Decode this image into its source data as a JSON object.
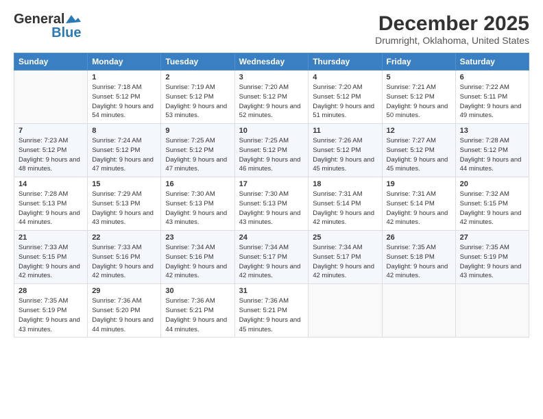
{
  "header": {
    "logo_general": "General",
    "logo_blue": "Blue",
    "title": "December 2025",
    "subtitle": "Drumright, Oklahoma, United States"
  },
  "weekdays": [
    "Sunday",
    "Monday",
    "Tuesday",
    "Wednesday",
    "Thursday",
    "Friday",
    "Saturday"
  ],
  "weeks": [
    [
      {
        "day": "",
        "sunrise": "",
        "sunset": "",
        "daylight": ""
      },
      {
        "day": "1",
        "sunrise": "Sunrise: 7:18 AM",
        "sunset": "Sunset: 5:12 PM",
        "daylight": "Daylight: 9 hours and 54 minutes."
      },
      {
        "day": "2",
        "sunrise": "Sunrise: 7:19 AM",
        "sunset": "Sunset: 5:12 PM",
        "daylight": "Daylight: 9 hours and 53 minutes."
      },
      {
        "day": "3",
        "sunrise": "Sunrise: 7:20 AM",
        "sunset": "Sunset: 5:12 PM",
        "daylight": "Daylight: 9 hours and 52 minutes."
      },
      {
        "day": "4",
        "sunrise": "Sunrise: 7:20 AM",
        "sunset": "Sunset: 5:12 PM",
        "daylight": "Daylight: 9 hours and 51 minutes."
      },
      {
        "day": "5",
        "sunrise": "Sunrise: 7:21 AM",
        "sunset": "Sunset: 5:12 PM",
        "daylight": "Daylight: 9 hours and 50 minutes."
      },
      {
        "day": "6",
        "sunrise": "Sunrise: 7:22 AM",
        "sunset": "Sunset: 5:11 PM",
        "daylight": "Daylight: 9 hours and 49 minutes."
      }
    ],
    [
      {
        "day": "7",
        "sunrise": "Sunrise: 7:23 AM",
        "sunset": "Sunset: 5:12 PM",
        "daylight": "Daylight: 9 hours and 48 minutes."
      },
      {
        "day": "8",
        "sunrise": "Sunrise: 7:24 AM",
        "sunset": "Sunset: 5:12 PM",
        "daylight": "Daylight: 9 hours and 47 minutes."
      },
      {
        "day": "9",
        "sunrise": "Sunrise: 7:25 AM",
        "sunset": "Sunset: 5:12 PM",
        "daylight": "Daylight: 9 hours and 47 minutes."
      },
      {
        "day": "10",
        "sunrise": "Sunrise: 7:25 AM",
        "sunset": "Sunset: 5:12 PM",
        "daylight": "Daylight: 9 hours and 46 minutes."
      },
      {
        "day": "11",
        "sunrise": "Sunrise: 7:26 AM",
        "sunset": "Sunset: 5:12 PM",
        "daylight": "Daylight: 9 hours and 45 minutes."
      },
      {
        "day": "12",
        "sunrise": "Sunrise: 7:27 AM",
        "sunset": "Sunset: 5:12 PM",
        "daylight": "Daylight: 9 hours and 45 minutes."
      },
      {
        "day": "13",
        "sunrise": "Sunrise: 7:28 AM",
        "sunset": "Sunset: 5:12 PM",
        "daylight": "Daylight: 9 hours and 44 minutes."
      }
    ],
    [
      {
        "day": "14",
        "sunrise": "Sunrise: 7:28 AM",
        "sunset": "Sunset: 5:13 PM",
        "daylight": "Daylight: 9 hours and 44 minutes."
      },
      {
        "day": "15",
        "sunrise": "Sunrise: 7:29 AM",
        "sunset": "Sunset: 5:13 PM",
        "daylight": "Daylight: 9 hours and 43 minutes."
      },
      {
        "day": "16",
        "sunrise": "Sunrise: 7:30 AM",
        "sunset": "Sunset: 5:13 PM",
        "daylight": "Daylight: 9 hours and 43 minutes."
      },
      {
        "day": "17",
        "sunrise": "Sunrise: 7:30 AM",
        "sunset": "Sunset: 5:13 PM",
        "daylight": "Daylight: 9 hours and 43 minutes."
      },
      {
        "day": "18",
        "sunrise": "Sunrise: 7:31 AM",
        "sunset": "Sunset: 5:14 PM",
        "daylight": "Daylight: 9 hours and 42 minutes."
      },
      {
        "day": "19",
        "sunrise": "Sunrise: 7:31 AM",
        "sunset": "Sunset: 5:14 PM",
        "daylight": "Daylight: 9 hours and 42 minutes."
      },
      {
        "day": "20",
        "sunrise": "Sunrise: 7:32 AM",
        "sunset": "Sunset: 5:15 PM",
        "daylight": "Daylight: 9 hours and 42 minutes."
      }
    ],
    [
      {
        "day": "21",
        "sunrise": "Sunrise: 7:33 AM",
        "sunset": "Sunset: 5:15 PM",
        "daylight": "Daylight: 9 hours and 42 minutes."
      },
      {
        "day": "22",
        "sunrise": "Sunrise: 7:33 AM",
        "sunset": "Sunset: 5:16 PM",
        "daylight": "Daylight: 9 hours and 42 minutes."
      },
      {
        "day": "23",
        "sunrise": "Sunrise: 7:34 AM",
        "sunset": "Sunset: 5:16 PM",
        "daylight": "Daylight: 9 hours and 42 minutes."
      },
      {
        "day": "24",
        "sunrise": "Sunrise: 7:34 AM",
        "sunset": "Sunset: 5:17 PM",
        "daylight": "Daylight: 9 hours and 42 minutes."
      },
      {
        "day": "25",
        "sunrise": "Sunrise: 7:34 AM",
        "sunset": "Sunset: 5:17 PM",
        "daylight": "Daylight: 9 hours and 42 minutes."
      },
      {
        "day": "26",
        "sunrise": "Sunrise: 7:35 AM",
        "sunset": "Sunset: 5:18 PM",
        "daylight": "Daylight: 9 hours and 42 minutes."
      },
      {
        "day": "27",
        "sunrise": "Sunrise: 7:35 AM",
        "sunset": "Sunset: 5:19 PM",
        "daylight": "Daylight: 9 hours and 43 minutes."
      }
    ],
    [
      {
        "day": "28",
        "sunrise": "Sunrise: 7:35 AM",
        "sunset": "Sunset: 5:19 PM",
        "daylight": "Daylight: 9 hours and 43 minutes."
      },
      {
        "day": "29",
        "sunrise": "Sunrise: 7:36 AM",
        "sunset": "Sunset: 5:20 PM",
        "daylight": "Daylight: 9 hours and 44 minutes."
      },
      {
        "day": "30",
        "sunrise": "Sunrise: 7:36 AM",
        "sunset": "Sunset: 5:21 PM",
        "daylight": "Daylight: 9 hours and 44 minutes."
      },
      {
        "day": "31",
        "sunrise": "Sunrise: 7:36 AM",
        "sunset": "Sunset: 5:21 PM",
        "daylight": "Daylight: 9 hours and 45 minutes."
      },
      {
        "day": "",
        "sunrise": "",
        "sunset": "",
        "daylight": ""
      },
      {
        "day": "",
        "sunrise": "",
        "sunset": "",
        "daylight": ""
      },
      {
        "day": "",
        "sunrise": "",
        "sunset": "",
        "daylight": ""
      }
    ]
  ]
}
